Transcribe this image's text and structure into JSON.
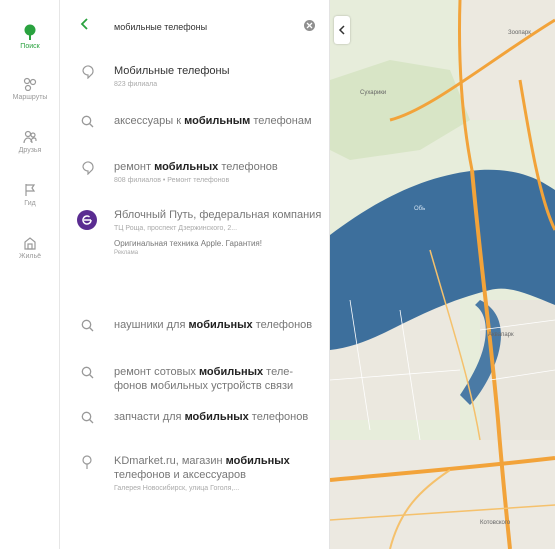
{
  "rail": {
    "items": [
      {
        "label": "Поиск",
        "icon": "pin-icon"
      },
      {
        "label": "Маршруты",
        "icon": "route-icon"
      },
      {
        "label": "Друзья",
        "icon": "friends-icon"
      },
      {
        "label": "Гид",
        "icon": "flag-icon"
      },
      {
        "label": "Жильё",
        "icon": "house-icon"
      }
    ]
  },
  "search": {
    "value": "мобильные телефоны"
  },
  "results": [
    {
      "title": "Мобильные телефоны",
      "sub": "823 филиала"
    },
    {
      "pre": "аксессуары к ",
      "bold": "мобильным",
      "post": " телефонам"
    },
    {
      "pre": "ремонт ",
      "bold": "мобильных",
      "post": " телефонов",
      "sub": "808 филиалов • Ремонт телефонов"
    },
    {
      "title": "Яблочный Путь, федеральная компания",
      "sub": "ТЦ Роща, проспект Дзержинского, 2...",
      "desc": "Оригинальная техника Apple. Гарантия!",
      "ad": "Реклама"
    },
    {
      "pre": "наушники для ",
      "bold": "мобильных",
      "post": " телефонов"
    },
    {
      "pre": "ремонт сотовых ",
      "bold": "мобильных",
      "post": " теле-фонов мобильных устройств связи"
    },
    {
      "pre": "запчасти для ",
      "bold": "мобильных",
      "post": " телефонов"
    },
    {
      "pre": "KDmarket.ru, магазин ",
      "bold": "мобильных",
      "post": " телефонов и аксессуаров",
      "sub": "Галерея Новосибирск, улица Гоголя,..."
    }
  ],
  "map": {
    "labels": [
      "Сухарики",
      "Обь",
      "Аквапарк",
      "Зоопарк",
      "Котовского"
    ]
  },
  "colors": {
    "accent": "#2aa23f",
    "road": "#f2a33a",
    "river": "#3d6f9c",
    "brand": "#5a2c91"
  }
}
